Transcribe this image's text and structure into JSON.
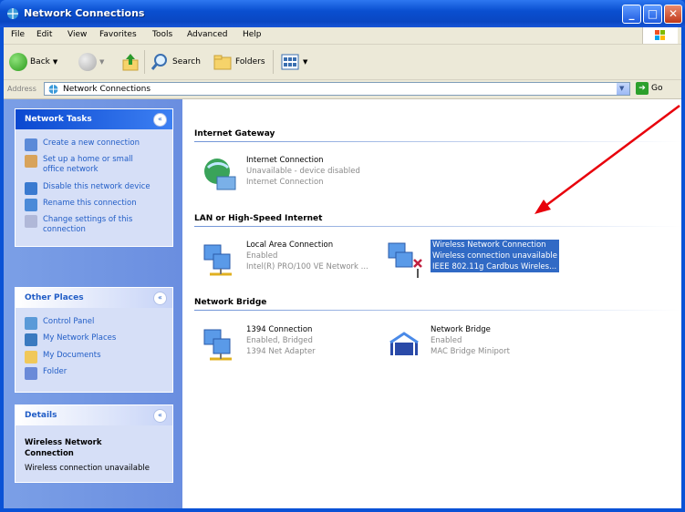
{
  "window": {
    "title": "Network Connections"
  },
  "menu": [
    "File",
    "Edit",
    "View",
    "Favorites",
    "Tools",
    "Advanced",
    "Help"
  ],
  "toolbar": {
    "back": "Back",
    "search": "Search",
    "folders": "Folders"
  },
  "address": {
    "label": "Address",
    "value": "Network Connections",
    "go": "Go"
  },
  "tasks": {
    "title": "Network Tasks",
    "items": [
      "Create a new connection",
      "Set up a home or small office network",
      "Disable this network device",
      "Rename this connection",
      "Change settings of this connection"
    ]
  },
  "places": {
    "title": "Other Places",
    "items": [
      "Control Panel",
      "My Network Places",
      "My Documents",
      "Folder"
    ]
  },
  "details": {
    "title": "Details",
    "name": "Wireless Network Connection",
    "status": "Wireless connection unavailable"
  },
  "groups": {
    "gateway": "Internet Gateway",
    "lan": "LAN or High-Speed Internet",
    "bridge": "Network Bridge"
  },
  "items": {
    "internet": {
      "name": "Internet Connection",
      "status": "Unavailable - device disabled",
      "type": "Internet Connection"
    },
    "local": {
      "name": "Local Area Connection",
      "status": "Enabled",
      "type": "Intel(R) PRO/100 VE Network ..."
    },
    "wireless": {
      "name": "Wireless Network Connection",
      "status": "Wireless connection unavailable",
      "type": "IEEE 802.11g Cardbus Wireles..."
    },
    "c1394": {
      "name": "1394 Connection",
      "status": "Enabled, Bridged",
      "type": "1394 Net Adapter"
    },
    "bridge": {
      "name": "Network Bridge",
      "status": "Enabled",
      "type": "MAC Bridge Miniport"
    }
  },
  "colors": {
    "xp_blue": "#0a52d6",
    "selection": "#316ac5",
    "arrow": "#e8000b"
  }
}
